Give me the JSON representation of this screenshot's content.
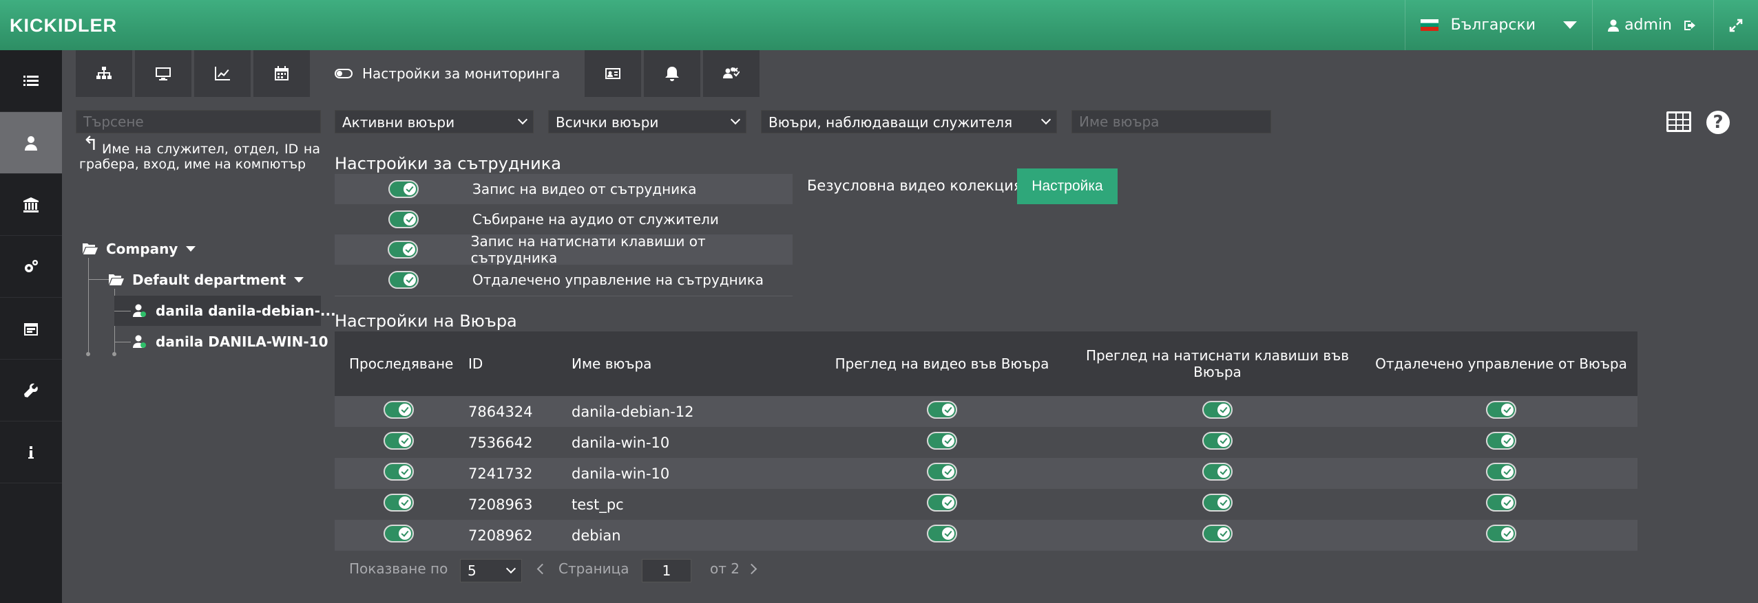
{
  "header": {
    "logo": "KICKIDLER",
    "language": "Български",
    "user": "admin"
  },
  "search": {
    "placeholder": "Търсене",
    "hint": "Име на служител, отдел, ID на грабера, вход, име на компютър"
  },
  "filters": {
    "viewers_status": "Активни вюъри",
    "viewers_all": "Всички вюъри",
    "viewers_watching": "Вюъри, наблюдаващи служителя",
    "viewer_name_placeholder": "Име вюъра"
  },
  "tabs": {
    "active_label": "Настройки за мониторинга"
  },
  "tree": {
    "company": "Company",
    "department": "Default department",
    "employees": [
      "danila danila-debian-...",
      "danila DANILA-WIN-10"
    ]
  },
  "employee_settings": {
    "title": "Настройки за сътрудника",
    "rows": [
      {
        "label": "Запис на видео от сътрудника",
        "on": true
      },
      {
        "label": "Събиране на аудио от служители",
        "on": true
      },
      {
        "label": "Запис на натиснати клавиши от сътрудника",
        "on": true
      },
      {
        "label": "Отдалечено управление на сътрудника",
        "on": true
      }
    ],
    "unconditional_label": "Безусловна видео колекция",
    "setup_button": "Настройка"
  },
  "viewer_settings": {
    "title": "Настройки на Вюъра",
    "columns": [
      "Проследяване",
      "ID",
      "Име вюъра",
      "Преглед на видео във Вюъра",
      "Преглед на натиснати клавиши във Вюъра",
      "Отдалечено управление от Вюъра"
    ],
    "rows": [
      {
        "id": "7864324",
        "name": "danila-debian-12"
      },
      {
        "id": "7536642",
        "name": "danila-win-10"
      },
      {
        "id": "7241732",
        "name": "danila-win-10"
      },
      {
        "id": "7208963",
        "name": "test_pc"
      },
      {
        "id": "7208962",
        "name": "debian"
      }
    ]
  },
  "pagination": {
    "show_label": "Показване по",
    "per_page": "5",
    "page_label": "Страница",
    "page": "1",
    "of_label": "от 2"
  }
}
